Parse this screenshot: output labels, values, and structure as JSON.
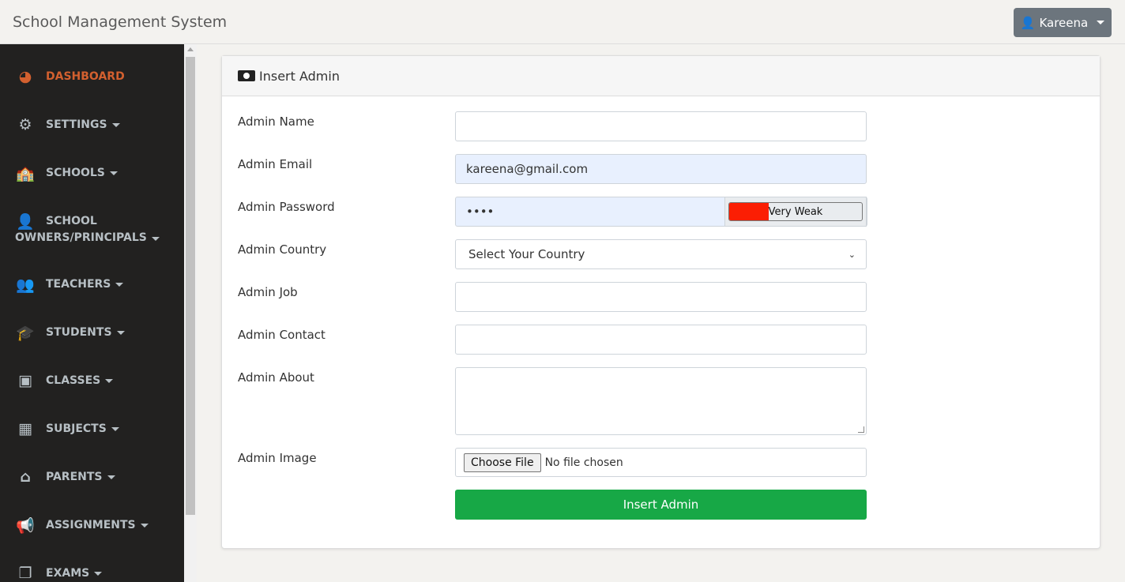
{
  "header": {
    "title": "School Management System",
    "user": "Kareena"
  },
  "sidebar": {
    "items": [
      {
        "label": "DASHBOARD",
        "icon": "tachometer-icon",
        "glyph": "◕",
        "active": true,
        "dropdown": false
      },
      {
        "label": "SETTINGS",
        "icon": "gear-icon",
        "glyph": "⚙",
        "dropdown": true
      },
      {
        "label": "SCHOOLS",
        "icon": "school-icon",
        "glyph": "🏫",
        "dropdown": true
      },
      {
        "label": "SCHOOL",
        "label2": "OWNERS/PRINCIPALS",
        "icon": "chalkboard-teacher-icon",
        "glyph": "👤",
        "dropdown": true
      },
      {
        "label": "TEACHERS",
        "icon": "users-icon",
        "glyph": "👥",
        "dropdown": true
      },
      {
        "label": "STUDENTS",
        "icon": "graduate-icon",
        "glyph": "🎓",
        "dropdown": true
      },
      {
        "label": "CLASSES",
        "icon": "classroom-icon",
        "glyph": "▣",
        "dropdown": true
      },
      {
        "label": "SUBJECTS",
        "icon": "boxes-icon",
        "glyph": "▦",
        "dropdown": true
      },
      {
        "label": "PARENTS",
        "icon": "house-user-icon",
        "glyph": "⌂",
        "dropdown": true
      },
      {
        "label": "ASSIGNMENTS",
        "icon": "bullhorn-icon",
        "glyph": "📢",
        "dropdown": true
      },
      {
        "label": "EXAMS",
        "icon": "copy-icon",
        "glyph": "❐",
        "dropdown": true
      }
    ]
  },
  "form": {
    "title": "Insert Admin",
    "name": {
      "label": "Admin Name",
      "value": ""
    },
    "email": {
      "label": "Admin Email",
      "value": "kareena@gmail.com"
    },
    "password": {
      "label": "Admin Password",
      "value": "••••",
      "strength": "Very Weak",
      "strength_percent": 30,
      "strength_color": "#fb1e03"
    },
    "country": {
      "label": "Admin Country",
      "value": "Select Your Country"
    },
    "job": {
      "label": "Admin Job",
      "value": ""
    },
    "contact": {
      "label": "Admin Contact",
      "value": ""
    },
    "about": {
      "label": "Admin About",
      "value": ""
    },
    "image": {
      "label": "Admin Image",
      "button": "Choose File",
      "status": "No file chosen"
    },
    "submit": "Insert Admin"
  }
}
